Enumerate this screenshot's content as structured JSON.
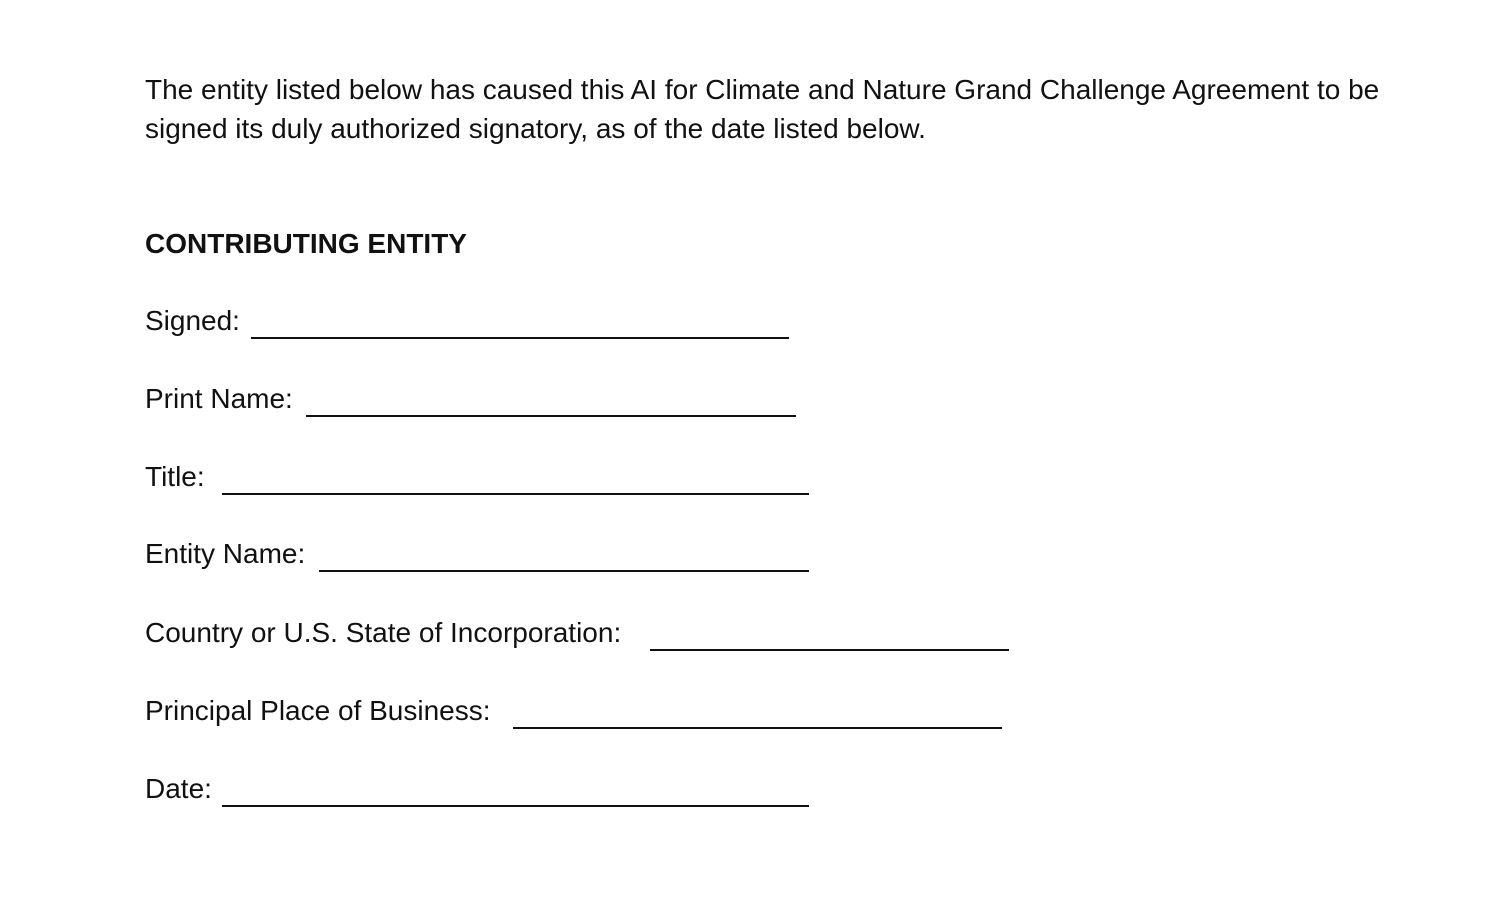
{
  "intro_text": "The entity listed below has caused this AI for Climate and Nature Grand Challenge Agreement to be signed its duly authorized signatory, as of the date listed below.",
  "section_heading": "CONTRIBUTING ENTITY",
  "fields": {
    "signed": "Signed:",
    "print_name": "Print Name:",
    "title": "Title:",
    "entity_name": "Entity Name:",
    "country_state": "Country or U.S. State of Incorporation:",
    "principal_place": "Principal Place of Business:",
    "date": "Date:"
  }
}
